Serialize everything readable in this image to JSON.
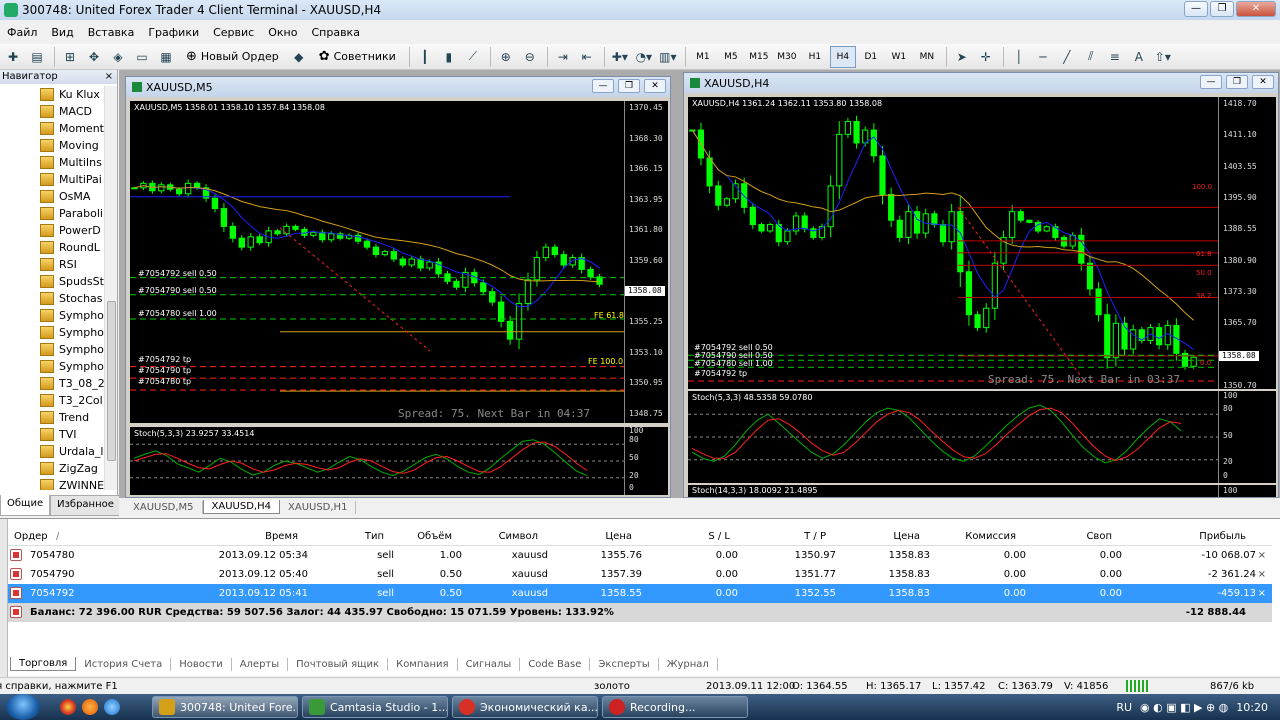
{
  "window": {
    "title": "300748: United Forex Trader 4 Client Terminal - XAUUSD,H4",
    "btn_min": "—",
    "btn_max": "❐",
    "btn_close": "✕"
  },
  "menu": [
    "Файл",
    "Вид",
    "Вставка",
    "Графики",
    "Сервис",
    "Окно",
    "Справка"
  ],
  "toolbar": {
    "new_order": "Новый Ордер",
    "advisors": "Советники",
    "timeframes": [
      "M1",
      "M5",
      "M15",
      "M30",
      "H1",
      "H4",
      "D1",
      "W1",
      "MN"
    ],
    "active_timeframe": "H4"
  },
  "navigator": {
    "title": "Навигатор",
    "close": "×",
    "items": [
      "Ku Klux",
      "MACD",
      "Moment",
      "Moving",
      "MultiIns",
      "MultiPai",
      "OsMA",
      "Paraboli",
      "PowerD",
      "RoundL",
      "RSI",
      "SpudsSt",
      "Stochas",
      "Sympho",
      "Sympho",
      "Sympho",
      "Sympho",
      "T3_08_2",
      "T3_2Col",
      "Trend",
      "TVI",
      "Urdala_l",
      "ZigZag",
      "ZWINNE"
    ],
    "tabs": [
      "Общие",
      "Избранное"
    ]
  },
  "chart_m5": {
    "window_title": "XAUUSD,M5",
    "header": "XAUUSD,M5  1358.01 1358.10 1357.84 1358.08",
    "prices": [
      "1370.45",
      "1368.30",
      "1366.15",
      "1363.95",
      "1361.80",
      "1359.60",
      "1357.45",
      "1355.25",
      "1353.10",
      "1350.95",
      "1348.75"
    ],
    "current_price": "1358.08",
    "orders": [
      "#7054792 sell 0.50",
      "#7054790 sell 0.50",
      "#7054780 sell 1.00"
    ],
    "tps": [
      "#7054792 tp",
      "#7054790 tp",
      "#7054780 tp"
    ],
    "fe1": "FE 61.8",
    "fe2": "FE 100.0",
    "spread": "Spread: 75. Next Bar in 04:37",
    "stoch_label": "Stoch(5,3,3) 23.9257 33.4514",
    "stoch_levels": [
      "100",
      "80",
      "50",
      "20",
      "0"
    ]
  },
  "chart_h4": {
    "window_title": "XAUUSD,H4",
    "header": "XAUUSD,H4  1361.24 1362.11 1353.80 1358.08",
    "prices": [
      "1418.70",
      "1411.10",
      "1403.55",
      "1395.90",
      "1388.55",
      "1380.90",
      "1373.30",
      "1365.70",
      "1358.08",
      "1350.70"
    ],
    "current_price": "1358.08",
    "orders": [
      "#7054792 sell 0.50",
      "#7054790 sell 0.50",
      "#7054780 sell 1.00"
    ],
    "tps": [
      "#7054792 tp"
    ],
    "fib_levels": [
      "100.0",
      "61.8",
      "50.0",
      "38.2",
      "0.0"
    ],
    "spread": "Spread: 75. Next Bar in 03:37",
    "stoch_label": "Stoch(5,3,3) 48.5358 59.0780",
    "stoch2_label": "Stoch(14,3,3) 18.0092 21.4895",
    "stoch_levels": [
      "100",
      "80",
      "50",
      "20",
      "0"
    ],
    "stoch2_level": "100"
  },
  "chart_tabs": [
    "XAUUSD,M5",
    "XAUUSD,H4",
    "XAUUSD,H1"
  ],
  "active_chart_tab": "XAUUSD,H4",
  "terminal": {
    "columns": [
      "Ордер",
      "/",
      "Время",
      "Тип",
      "Объём",
      "Символ",
      "Цена",
      "S / L",
      "T / P",
      "Цена",
      "Комиссия",
      "Своп",
      "Прибыль"
    ],
    "orders": [
      {
        "ticket": "7054780",
        "time": "2013.09.12 05:34",
        "type": "sell",
        "volume": "1.00",
        "symbol": "xauusd",
        "price": "1355.76",
        "sl": "0.00",
        "tp": "1350.97",
        "cur": "1358.83",
        "commission": "0.00",
        "swap": "0.00",
        "profit": "-10 068.07"
      },
      {
        "ticket": "7054790",
        "time": "2013.09.12 05:40",
        "type": "sell",
        "volume": "0.50",
        "symbol": "xauusd",
        "price": "1357.39",
        "sl": "0.00",
        "tp": "1351.77",
        "cur": "1358.83",
        "commission": "0.00",
        "swap": "0.00",
        "profit": "-2 361.24"
      },
      {
        "ticket": "7054792",
        "time": "2013.09.12 05:41",
        "type": "sell",
        "volume": "0.50",
        "symbol": "xauusd",
        "price": "1358.55",
        "sl": "0.00",
        "tp": "1352.55",
        "cur": "1358.83",
        "commission": "0.00",
        "swap": "0.00",
        "profit": "-459.13"
      }
    ],
    "balance_line": "Баланс: 72 396.00 RUR  Средства: 59 507.56  Залог: 44 435.97  Свободно: 15 071.59  Уровень: 133.92%",
    "total_profit": "-12 888.44",
    "close_glyph": "×",
    "tabs": [
      "Торговля",
      "История Счета",
      "Новости",
      "Алерты",
      "Почтовый ящик",
      "Компания",
      "Сигналы",
      "Code Base",
      "Эксперты",
      "Журнал"
    ],
    "active_tab": "Торговля"
  },
  "statusbar": {
    "help": "Для справки, нажмите F1",
    "profile": "золото",
    "datetime": "2013.09.11 12:00",
    "open": "O: 1364.55",
    "high": "H: 1365.17",
    "low": "L: 1357.42",
    "close": "C: 1363.79",
    "volume": "V: 41856",
    "traffic": "867/6 kb"
  },
  "taskbar": {
    "tasks": [
      "300748: United Fore...",
      "Camtasia Studio - 1...",
      "Экономический ка...",
      "Recording..."
    ],
    "lang": "RU",
    "time": "10:20"
  },
  "colors": {
    "bull_candle": "#00ff00",
    "bear_candle": "#00ff00",
    "ma_fast": "#2020ff",
    "ma_slow": "#d4a017",
    "order_line": "#00cc00",
    "tp_line": "#ff2020",
    "fibo": "#c00000",
    "stoch_main": "#00b000",
    "stoch_signal": "#ff2020",
    "selection": "#3399ff"
  },
  "chart_data": [
    {
      "type": "line",
      "title": "XAUUSD,M5",
      "ylim": [
        1348.75,
        1370.45
      ],
      "close": [
        1364.6,
        1364.9,
        1364.4,
        1364.8,
        1364.5,
        1364.2,
        1364.9,
        1364.6,
        1363.9,
        1363.2,
        1362.0,
        1361.2,
        1360.6,
        1361.3,
        1360.9,
        1361.7,
        1361.5,
        1362.0,
        1361.8,
        1361.4,
        1361.6,
        1361.1,
        1361.5,
        1361.2,
        1361.4,
        1361.0,
        1360.6,
        1360.1,
        1360.3,
        1359.8,
        1359.4,
        1359.8,
        1359.2,
        1359.6,
        1358.8,
        1358.3,
        1357.9,
        1358.9,
        1358.2,
        1357.6,
        1356.9,
        1355.6,
        1354.4,
        1356.8,
        1358.4,
        1359.9,
        1360.6,
        1360.1,
        1359.4,
        1359.9,
        1359.1,
        1358.6,
        1358.1
      ],
      "sell_entries": [
        1358.55,
        1357.39,
        1355.76
      ],
      "take_profits": [
        1352.55,
        1351.77,
        1350.97
      ],
      "stoch_k": [
        55,
        62,
        68,
        60,
        45,
        38,
        30,
        42,
        55,
        48,
        35,
        25,
        30,
        42,
        50,
        46,
        38,
        30,
        36,
        48,
        58,
        52,
        40,
        30,
        24,
        32,
        44,
        56,
        62,
        54,
        40,
        30,
        26,
        38,
        55,
        70,
        85,
        88,
        80,
        65,
        48,
        32,
        24
      ],
      "stoch_d": [
        50,
        56,
        62,
        63,
        55,
        46,
        38,
        36,
        44,
        50,
        46,
        36,
        30,
        34,
        42,
        46,
        44,
        38,
        34,
        38,
        48,
        54,
        50,
        40,
        31,
        28,
        34,
        46,
        56,
        58,
        50,
        40,
        31,
        30,
        40,
        55,
        70,
        82,
        84,
        76,
        62,
        46,
        33
      ],
      "stoch_ylim": [
        0,
        100
      ]
    },
    {
      "type": "line",
      "title": "XAUUSD,H4",
      "ylim": [
        1350.7,
        1418.7
      ],
      "close": [
        1411.0,
        1404.5,
        1398.0,
        1393.5,
        1395.0,
        1398.5,
        1393.0,
        1389.0,
        1387.5,
        1389.0,
        1385.0,
        1387.5,
        1391.0,
        1388.0,
        1386.0,
        1388.5,
        1398.0,
        1410.0,
        1413.0,
        1408.0,
        1411.0,
        1405.0,
        1396.0,
        1390.0,
        1386.0,
        1392.0,
        1387.0,
        1391.5,
        1389.0,
        1385.0,
        1392.0,
        1378.0,
        1368.0,
        1365.0,
        1369.5,
        1380.0,
        1386.0,
        1392.0,
        1390.0,
        1389.5,
        1387.5,
        1388.5,
        1386.0,
        1384.0,
        1386.5,
        1380.0,
        1374.0,
        1368.0,
        1358.0,
        1366.0,
        1360.0,
        1364.5,
        1362.0,
        1365.0,
        1361.0,
        1365.5,
        1359.0,
        1356.0,
        1358.08
      ],
      "fib_levels": [
        "100.0",
        "61.8",
        "50.0",
        "38.2",
        "0.0"
      ],
      "stoch_k": [
        30,
        22,
        18,
        25,
        40,
        58,
        72,
        80,
        68,
        55,
        42,
        30,
        22,
        28,
        40,
        55,
        70,
        82,
        88,
        85,
        75,
        60,
        45,
        32,
        22,
        18,
        25,
        38,
        52,
        66,
        78,
        88,
        92,
        85,
        70,
        52,
        36,
        24,
        16,
        20,
        32,
        48,
        62,
        74,
        70,
        58
      ],
      "stoch_d": [
        35,
        28,
        22,
        22,
        30,
        45,
        60,
        72,
        74,
        66,
        55,
        42,
        32,
        26,
        30,
        42,
        56,
        70,
        80,
        85,
        82,
        72,
        58,
        45,
        33,
        24,
        22,
        28,
        40,
        54,
        66,
        78,
        86,
        88,
        82,
        68,
        52,
        37,
        25,
        19,
        24,
        34,
        48,
        62,
        70,
        68
      ],
      "stoch_ylim": [
        0,
        100
      ]
    }
  ]
}
